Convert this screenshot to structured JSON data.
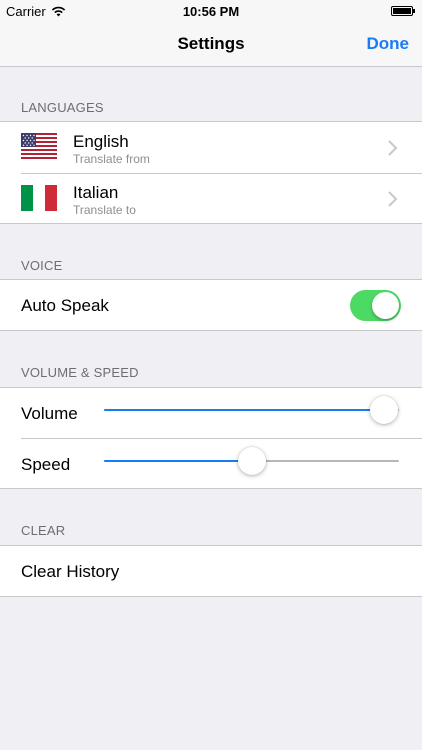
{
  "status_bar": {
    "carrier": "Carrier",
    "time": "10:56 PM"
  },
  "nav": {
    "title": "Settings",
    "done_label": "Done"
  },
  "languages": {
    "header": "LANGUAGES",
    "items": [
      {
        "name": "English",
        "subtitle": "Translate from",
        "flag": "us-flag-icon"
      },
      {
        "name": "Italian",
        "subtitle": "Translate to",
        "flag": "italy-flag-icon"
      }
    ]
  },
  "voice": {
    "header": "VOICE",
    "auto_speak_label": "Auto Speak",
    "auto_speak_on": true
  },
  "volume_speed": {
    "header": "VOLUME & SPEED",
    "volume_label": "Volume",
    "volume_value": 0.95,
    "speed_label": "Speed",
    "speed_value": 0.5
  },
  "clear": {
    "header": "CLEAR",
    "clear_history_label": "Clear History"
  },
  "colors": {
    "accent": "#1a7cf5",
    "toggle_on": "#4cd964",
    "background": "#efeff4"
  }
}
